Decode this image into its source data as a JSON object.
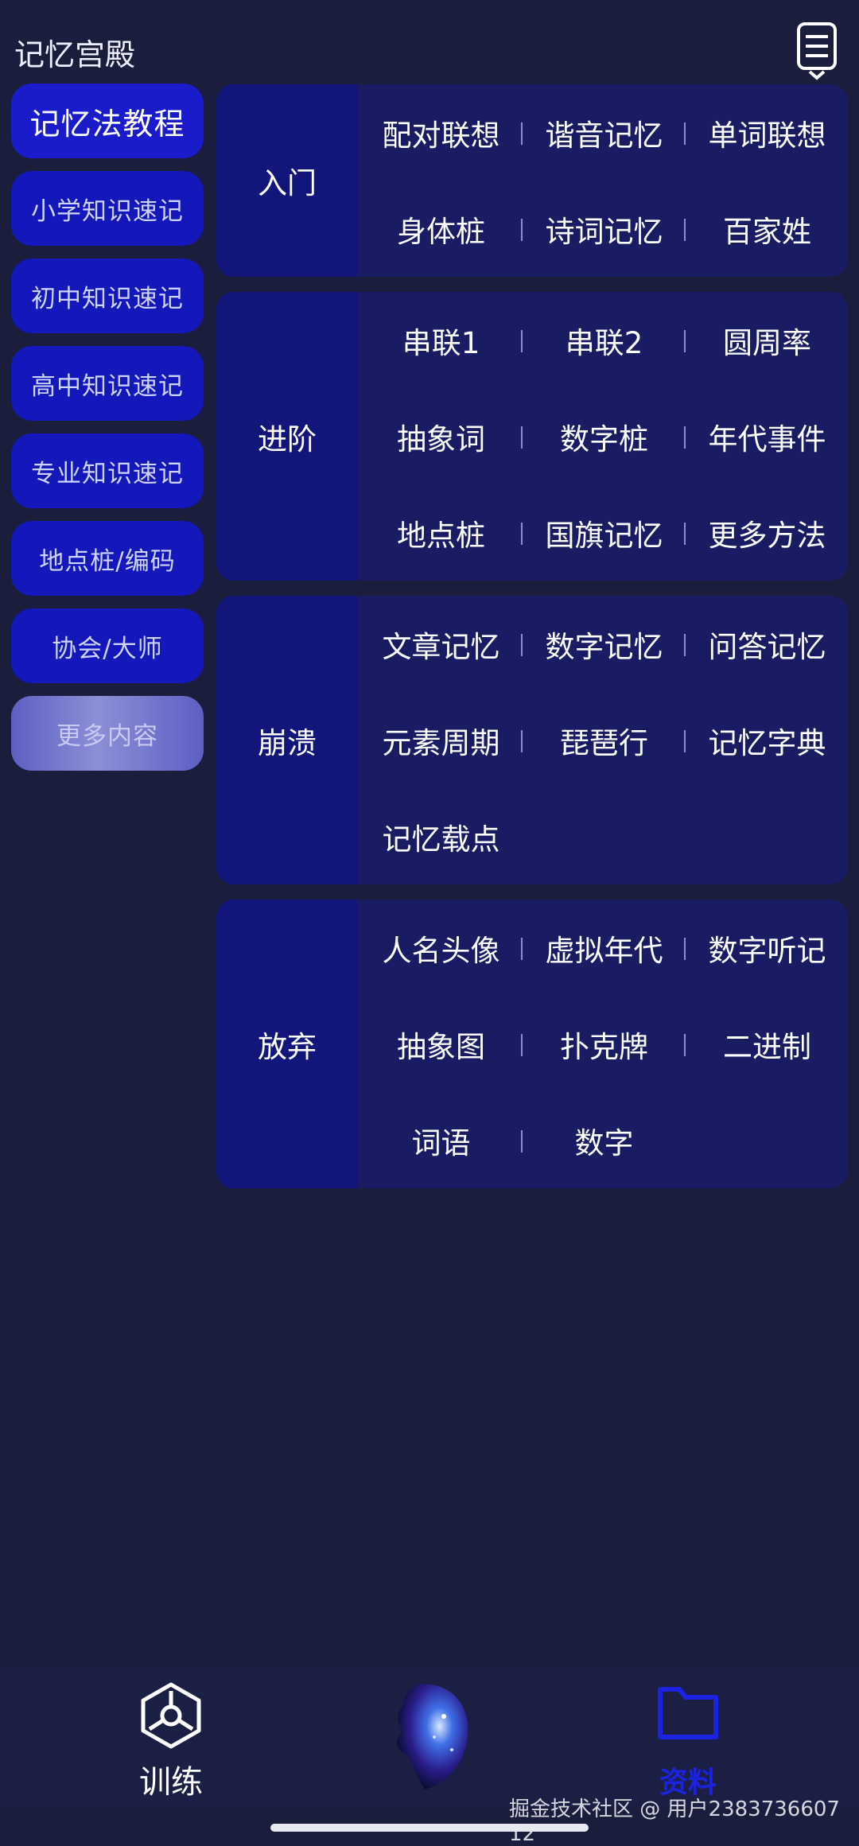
{
  "header": {
    "title": "记忆宫殿",
    "menu_icon": "list-icon"
  },
  "sidebar": {
    "items": [
      {
        "label": "记忆法教程",
        "active": true
      },
      {
        "label": "小学知识速记"
      },
      {
        "label": "初中知识速记"
      },
      {
        "label": "高中知识速记"
      },
      {
        "label": "专业知识速记"
      },
      {
        "label": "地点桩/编码"
      },
      {
        "label": "协会/大师"
      },
      {
        "label": "更多内容"
      }
    ]
  },
  "sections": [
    {
      "title": "入门",
      "items": [
        "配对联想",
        "谐音记忆",
        "单词联想",
        "身体桩",
        "诗词记忆",
        "百家姓"
      ]
    },
    {
      "title": "进阶",
      "items": [
        "串联1",
        "串联2",
        "圆周率",
        "抽象词",
        "数字桩",
        "年代事件",
        "地点桩",
        "国旗记忆",
        "更多方法"
      ]
    },
    {
      "title": "崩溃",
      "items": [
        "文章记忆",
        "数字记忆",
        "问答记忆",
        "元素周期",
        "琵琶行",
        "记忆字典",
        "记忆载点"
      ]
    },
    {
      "title": "放弃",
      "items": [
        "人名头像",
        "虚拟年代",
        "数字听记",
        "抽象图",
        "扑克牌",
        "二进制",
        "词语",
        "数字"
      ]
    }
  ],
  "bottom_nav": {
    "train_label": "训练",
    "data_label": "资料",
    "center_icon": "brain-avatar-icon"
  },
  "watermark": "掘金技术社区 @ 用户2383736607​12",
  "colors": {
    "background": "#1b1d3d",
    "sidebar_button": "#1417b9",
    "section_bg": "#191c63",
    "section_title_bg": "#12157a",
    "active_tab": "#1b22e0"
  }
}
